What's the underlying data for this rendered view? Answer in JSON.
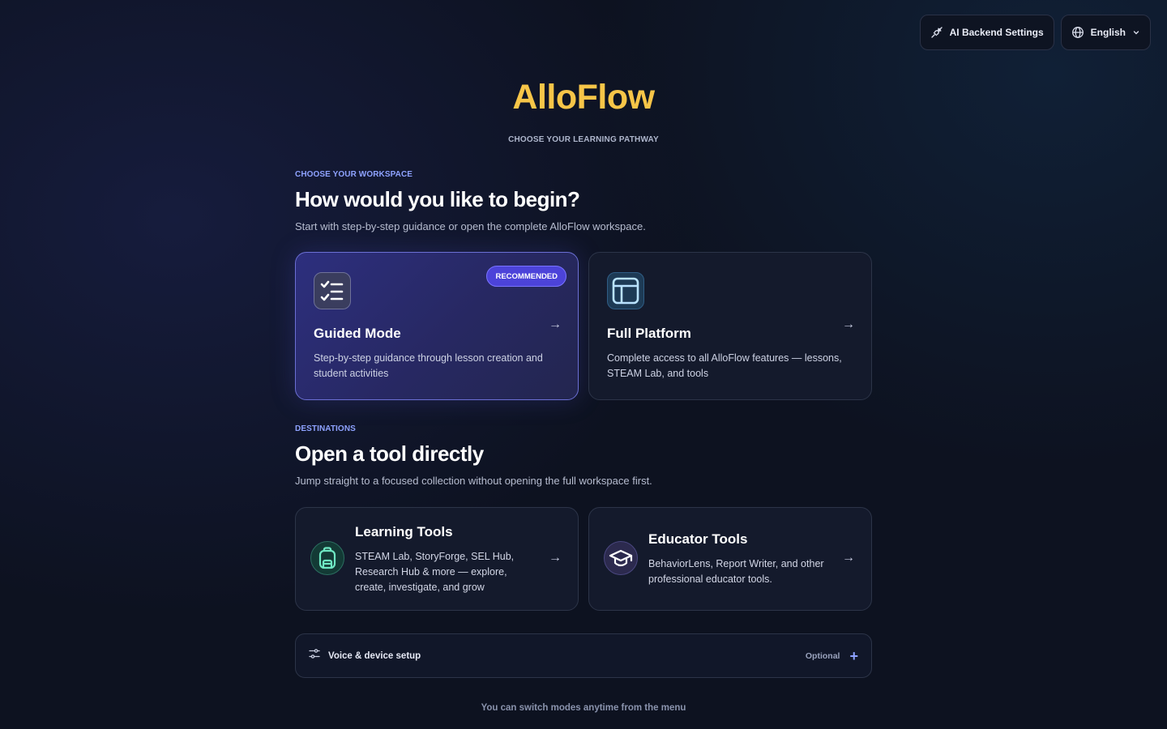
{
  "top_bar": {
    "ai_backend_label": "AI Backend Settings",
    "language_label": "English"
  },
  "brand": {
    "title": "AlloFlow",
    "tagline": "CHOOSE YOUR LEARNING PATHWAY"
  },
  "workspace_section": {
    "eyebrow": "CHOOSE YOUR WORKSPACE",
    "heading": "How would you like to begin?",
    "subtitle": "Start with step-by-step guidance or open the complete AlloFlow workspace.",
    "cards": [
      {
        "title": "Guided Mode",
        "description": "Step-by-step guidance through lesson creation and student activities",
        "badge": "RECOMMENDED",
        "icon": "checklist-icon",
        "arrow": "→"
      },
      {
        "title": "Full Platform",
        "description": "Complete access to all AlloFlow features — lessons, STEAM Lab, and tools",
        "icon": "layout-icon",
        "arrow": "→"
      }
    ]
  },
  "destinations_section": {
    "eyebrow": "DESTINATIONS",
    "heading": "Open a tool directly",
    "subtitle": "Jump straight to a focused collection without opening the full workspace first.",
    "cards": [
      {
        "title": "Learning Tools",
        "description": "STEAM Lab, StoryForge, SEL Hub, Research Hub & more — explore, create, investigate, and grow",
        "icon": "backpack-icon",
        "arrow": "→"
      },
      {
        "title": "Educator Tools",
        "description": "BehaviorLens, Report Writer, and other professional educator tools.",
        "icon": "graduation-cap-icon",
        "arrow": "→"
      }
    ]
  },
  "voice_setup": {
    "label": "Voice & device setup",
    "optional_label": "Optional",
    "expand_symbol": "+"
  },
  "footer": {
    "text": "You can switch modes anytime from the menu"
  },
  "colors": {
    "brand": "#f7c548",
    "accent": "#8ea2ff",
    "badge": "#4c43d9",
    "background": "#0d1220"
  }
}
